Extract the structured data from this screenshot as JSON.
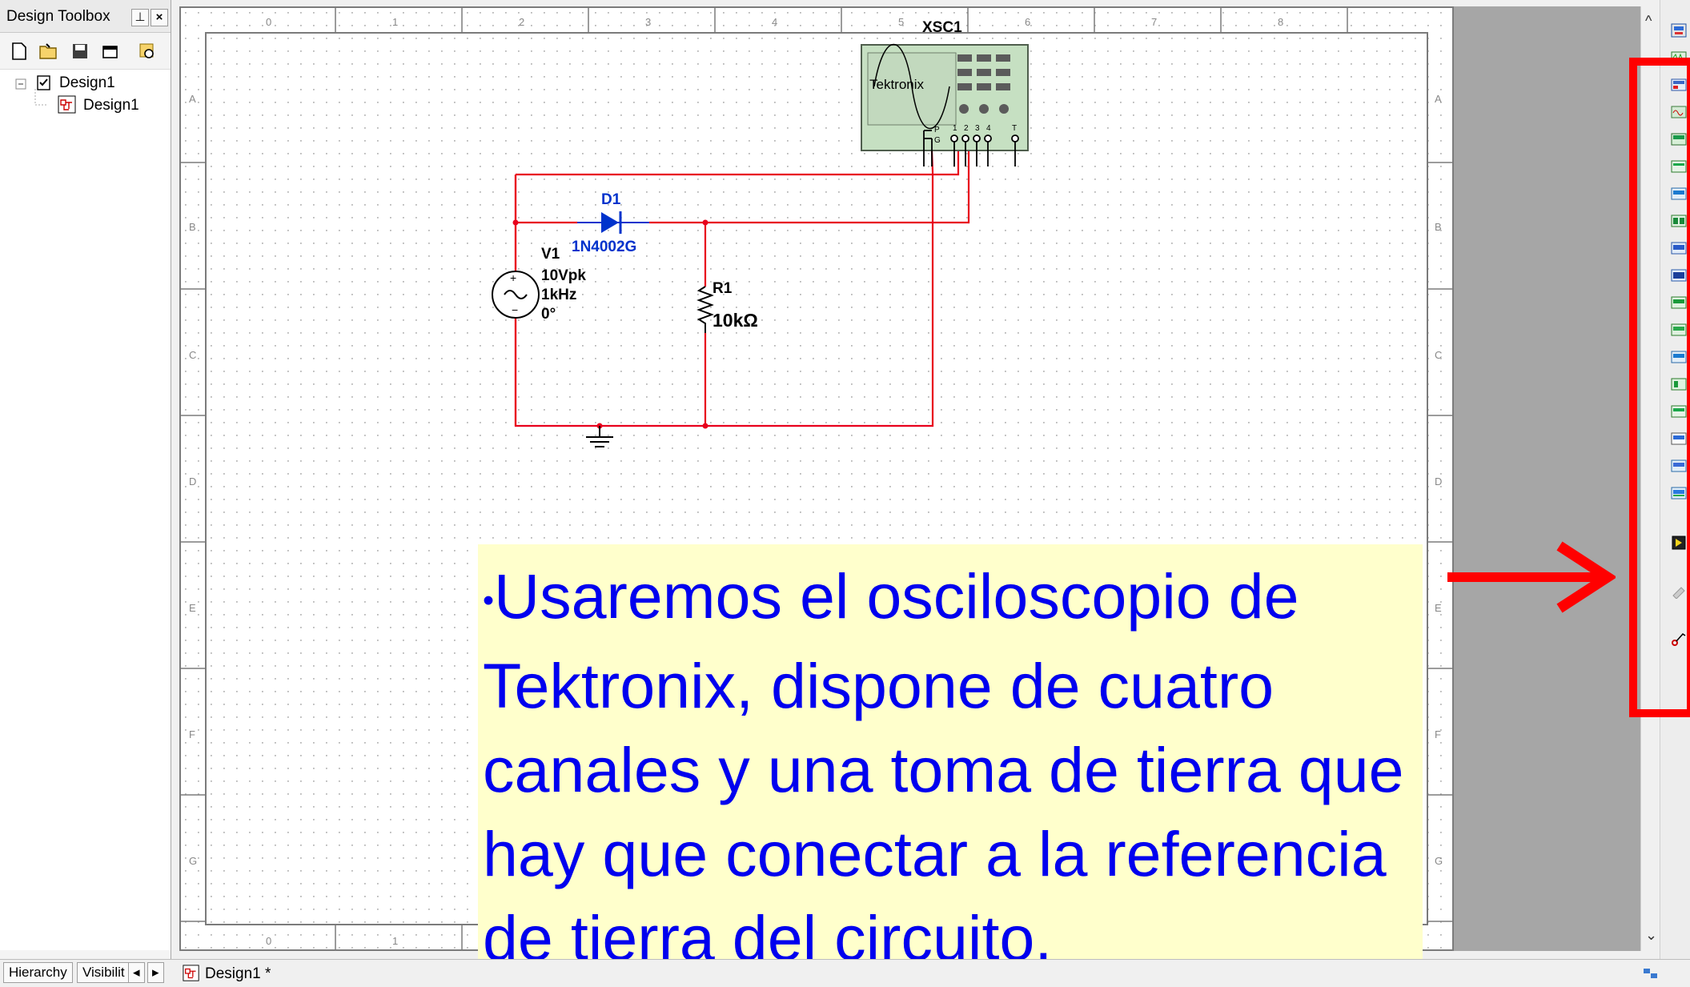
{
  "toolbox": {
    "title": "Design Toolbox",
    "dock_btn": "⊥",
    "close_btn": "×",
    "tree": {
      "root": "Design1",
      "child": "Design1"
    }
  },
  "bottom": {
    "tab_hierarchy": "Hierarchy",
    "tab_visibility": "Visibilit",
    "left_arrow": "◂",
    "right_arrow": "▸",
    "design_tab": "Design1 *"
  },
  "scroll": {
    "up": "^",
    "down": "⌄"
  },
  "ruler": {
    "numbers": [
      "0",
      "1",
      "2",
      "3",
      "4",
      "5",
      "6",
      "7",
      "8"
    ],
    "letters": [
      "A",
      "B",
      "C",
      "D",
      "E",
      "F",
      "G"
    ]
  },
  "circuit": {
    "scope": {
      "ref": "XSC1",
      "brand": "Tektronix",
      "pin_labels": [
        "P",
        "G",
        "1",
        "2",
        "3",
        "4",
        "T"
      ]
    },
    "diode": {
      "ref": "D1",
      "model": "1N4002G"
    },
    "source": {
      "ref": "V1",
      "amplitude": "10Vpk",
      "frequency": "1kHz",
      "phase": "0°"
    },
    "resistor": {
      "ref": "R1",
      "value": "10kΩ"
    }
  },
  "callout": {
    "text": "Usaremos el osciloscopio de Tektronix, dispone de cuatro canales y una toma de tierra que hay que conectar a la referencia de tierra del circuito.",
    "bullet": "•"
  },
  "colors": {
    "wire": "#e8001c",
    "annotation_blue": "#0000ee",
    "highlight_red": "#ff0000",
    "callout_bg": "#ffffcc"
  }
}
